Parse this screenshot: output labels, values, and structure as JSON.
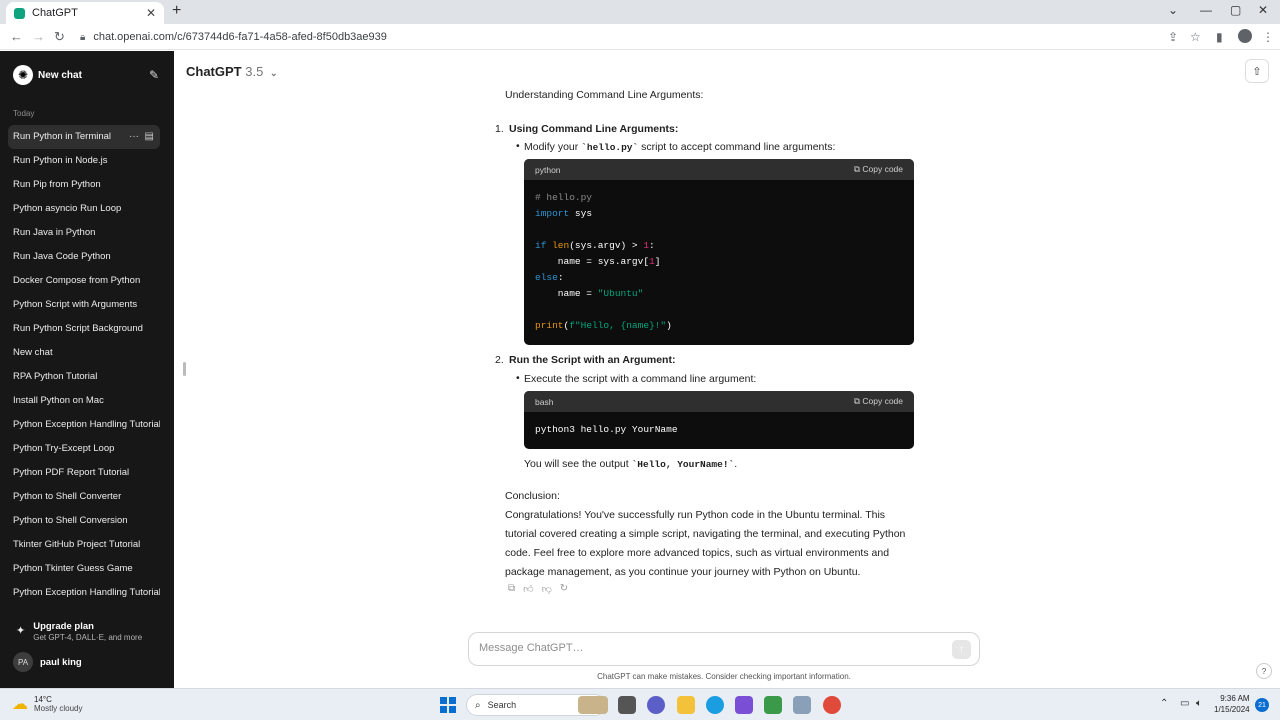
{
  "browser": {
    "tab_title": "ChatGPT",
    "tab_close": "✕",
    "new_tab": "+",
    "url": "chat.openai.com/c/673744d6-fa71-4a58-afed-8f50db3ae939"
  },
  "sidebar": {
    "new_chat": "New chat",
    "section_label": "Today",
    "items": [
      "Run Python in Terminal",
      "Run Python in Node.js",
      "Run Pip from Python",
      "Python asyncio Run Loop",
      "Run Java in Python",
      "Run Java Code Python",
      "Docker Compose from Python",
      "Python Script with Arguments",
      "Run Python Script Background",
      "New chat",
      "RPA Python Tutorial",
      "Install Python on Mac",
      "Python Exception Handling Tutorial",
      "Python Try-Except Loop",
      "Python PDF Report Tutorial",
      "Python to Shell Converter",
      "Python to Shell Conversion",
      "Tkinter GitHub Project Tutorial",
      "Python Tkinter Guess Game",
      "Python Exception Handling Tutorial"
    ],
    "upgrade_title": "Upgrade plan",
    "upgrade_sub": "Get GPT-4, DALL·E, and more",
    "user_initials": "PA",
    "user_name": "paul king"
  },
  "header": {
    "model_name": "ChatGPT",
    "model_version": "3.5"
  },
  "message": {
    "intro": "Understanding Command Line Arguments:",
    "step1": {
      "num": "1.",
      "title": "Using Command Line Arguments:",
      "bullet_pre": "Modify your ",
      "bullet_code": "`hello.py`",
      "bullet_post": " script to accept command line arguments:"
    },
    "code1": {
      "lang": "python",
      "copy": "Copy code"
    },
    "step2": {
      "num": "2.",
      "title": "Run the Script with an Argument:",
      "bullet": "Execute the script with a command line argument:"
    },
    "code2": {
      "lang": "bash",
      "copy": "Copy code",
      "code": "python3 hello.py YourName"
    },
    "output_pre": "You will see the output ",
    "output_code": "`Hello, YourName!`",
    "output_post": ".",
    "conclusion_label": "Conclusion:",
    "conclusion_text": "Congratulations! You've successfully run Python code in the Ubuntu terminal. This tutorial covered creating a simple script, navigating the terminal, and executing Python code. Feel free to explore more advanced topics, such as virtual environments and package management, as you continue your journey with Python on Ubuntu."
  },
  "composer": {
    "placeholder": "Message ChatGPT…",
    "disclaimer": "ChatGPT can make mistakes. Consider checking important information.",
    "help": "?"
  },
  "taskbar": {
    "temp": "14°C",
    "weather": "Mostly cloudy",
    "search": "Search",
    "time": "9:36 AM",
    "date": "1/15/2024",
    "notifications": "21"
  },
  "colors": {
    "sidebar_bg": "#171717",
    "code_bg": "#0d0d0d",
    "code_header_bg": "#2f2f2f",
    "keyword": "#2e95d3",
    "function": "#e9950c",
    "number": "#df3079",
    "string": "#00a67d"
  }
}
